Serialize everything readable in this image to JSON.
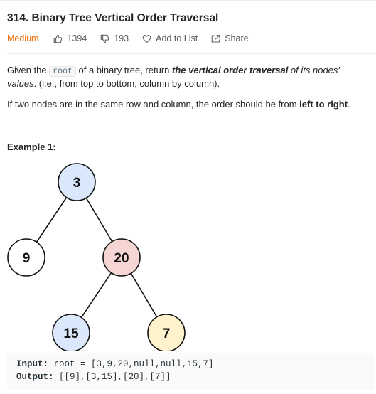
{
  "problem": {
    "title": "314. Binary Tree Vertical Order Traversal",
    "difficulty": "Medium",
    "likes": "1394",
    "dislikes": "193",
    "add_to_list": "Add to List",
    "share": "Share"
  },
  "description": {
    "p1_a": "Given the ",
    "p1_code": "root",
    "p1_b": " of a binary tree, return ",
    "p1_bold": "the vertical order traversal",
    "p1_c": " of its nodes'",
    "p2_italic": "values",
    "p2_rest": ". (i.e., from top to bottom, column by column).",
    "p3_a": "If two nodes are in the same row and column, the order should be from ",
    "p3_bold": "left to right",
    "p3_end": "."
  },
  "example": {
    "title": "Example 1:",
    "input_label": "Input:",
    "input_value": " root = [3,9,20,null,null,15,7]",
    "output_label": "Output:",
    "output_value": " [[9],[3,15],[20],[7]]"
  },
  "tree": {
    "nodes": [
      {
        "label": "3",
        "fill": "#dbe8fb"
      },
      {
        "label": "9",
        "fill": "#ffffff"
      },
      {
        "label": "20",
        "fill": "#f6d5d5"
      },
      {
        "label": "15",
        "fill": "#dbe8fb"
      },
      {
        "label": "7",
        "fill": "#fdf2cc"
      }
    ]
  },
  "colors": {
    "difficulty": "#ef6c00"
  }
}
